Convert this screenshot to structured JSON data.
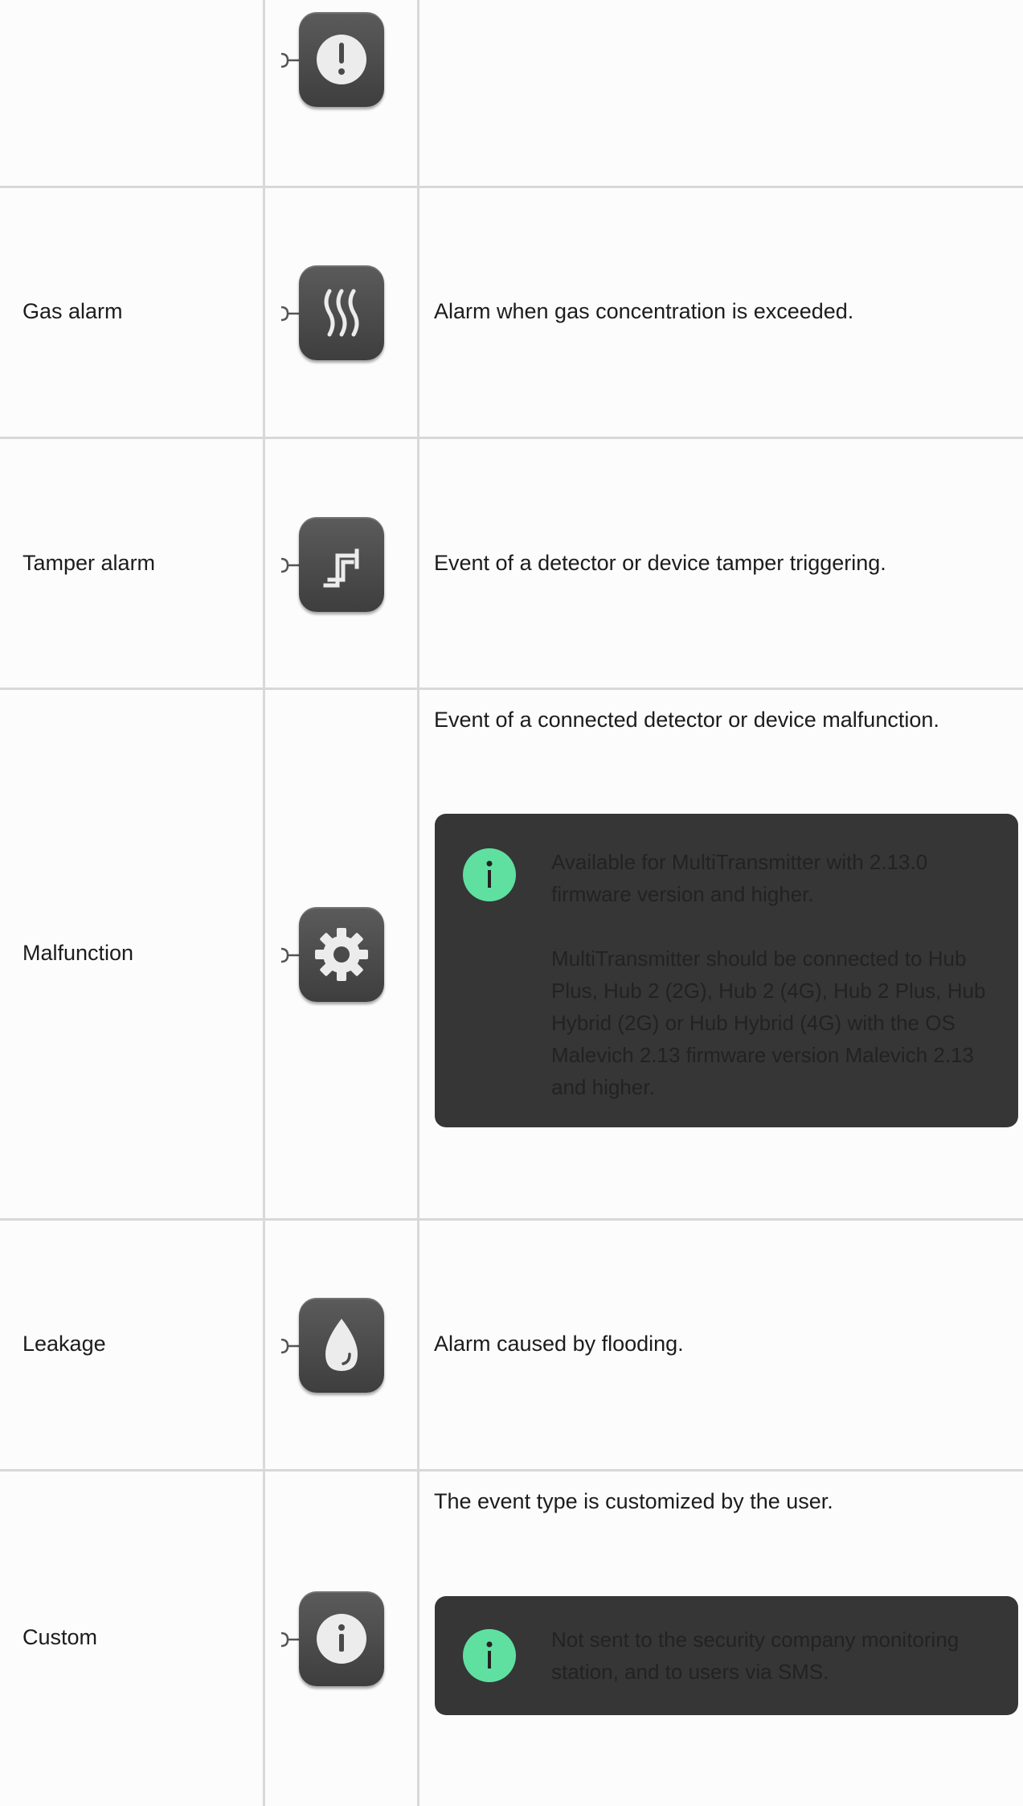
{
  "rows": [
    {
      "name": "",
      "icon": "exclamation-icon",
      "description": ""
    },
    {
      "name": "Gas alarm",
      "icon": "gas-waves-icon",
      "description": "Alarm when gas concentration is exceeded."
    },
    {
      "name": "Tamper alarm",
      "icon": "tamper-icon",
      "description": "Event of a detector or device tamper triggering."
    },
    {
      "name": "Malfunction",
      "icon": "gear-icon",
      "description": "Event of a connected detector or device malfunction.",
      "note": {
        "icon": "info-icon",
        "paragraphs": [
          "Available for MultiTransmitter with 2.13.0 firmware version and higher.",
          "MultiTransmitter should be connected to Hub Plus, Hub 2 (2G), Hub 2 (4G), Hub 2 Plus, Hub Hybrid (2G) or Hub Hybrid (4G) with the OS Malevich 2.13 firmware version Malevich 2.13 and higher."
        ]
      }
    },
    {
      "name": "Leakage",
      "icon": "water-drop-icon",
      "description": "Alarm caused by flooding."
    },
    {
      "name": "Custom",
      "icon": "info-icon",
      "description": "The event type is customized by the user.",
      "note": {
        "icon": "info-icon",
        "paragraphs": [
          "Not sent to the security company monitoring station, and to users via SMS."
        ]
      }
    }
  ],
  "colors": {
    "icon_tile": "#4a4a4a",
    "note_background": "#363636",
    "note_accent": "#5fe0a0",
    "grid_lines": "#d8d8d8"
  }
}
